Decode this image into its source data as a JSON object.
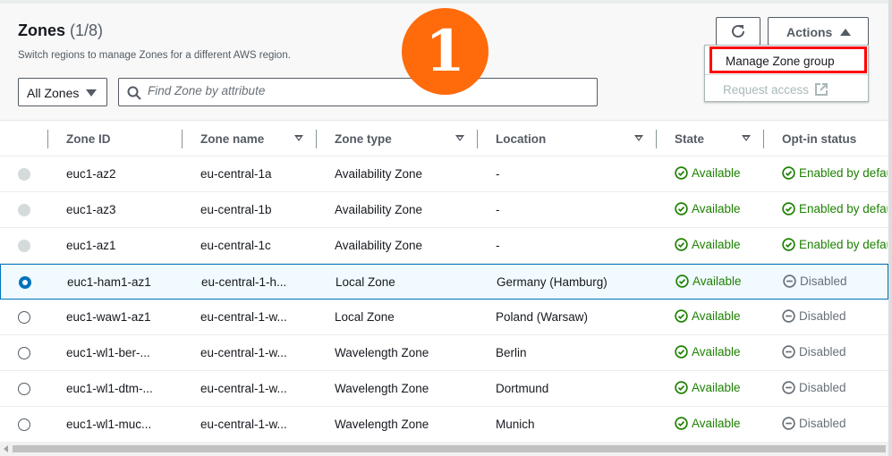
{
  "header": {
    "title": "Zones",
    "count": "(1/8)",
    "subtitle": "Switch regions to manage Zones for a different AWS region."
  },
  "filter": {
    "selected": "All Zones",
    "search_placeholder": "Find Zone by attribute"
  },
  "toolbar": {
    "refresh_icon": "refresh-icon",
    "actions_label": "Actions"
  },
  "actions_menu": {
    "items": [
      {
        "label": "Manage Zone group",
        "highlighted": true
      },
      {
        "label": "Request access",
        "disabled": true,
        "icon": "external-link-icon"
      }
    ]
  },
  "annotation": {
    "step": "1",
    "color": "#ff6a0b"
  },
  "table": {
    "columns": [
      "Zone ID",
      "Zone name",
      "Zone type",
      "Location",
      "State",
      "Opt-in status"
    ],
    "rows": [
      {
        "zone_id": "euc1-az2",
        "zone_name": "eu-central-1a",
        "zone_type": "Availability Zone",
        "location": "-",
        "state": "Available",
        "opt_in": "Enabled by default",
        "selectable": false,
        "selected": false
      },
      {
        "zone_id": "euc1-az3",
        "zone_name": "eu-central-1b",
        "zone_type": "Availability Zone",
        "location": "-",
        "state": "Available",
        "opt_in": "Enabled by default",
        "selectable": false,
        "selected": false
      },
      {
        "zone_id": "euc1-az1",
        "zone_name": "eu-central-1c",
        "zone_type": "Availability Zone",
        "location": "-",
        "state": "Available",
        "opt_in": "Enabled by default",
        "selectable": false,
        "selected": false
      },
      {
        "zone_id": "euc1-ham1-az1",
        "zone_name": "eu-central-1-h...",
        "zone_type": "Local Zone",
        "location": "Germany (Hamburg)",
        "state": "Available",
        "opt_in": "Disabled",
        "selectable": true,
        "selected": true
      },
      {
        "zone_id": "euc1-waw1-az1",
        "zone_name": "eu-central-1-w...",
        "zone_type": "Local Zone",
        "location": "Poland (Warsaw)",
        "state": "Available",
        "opt_in": "Disabled",
        "selectable": true,
        "selected": false
      },
      {
        "zone_id": "euc1-wl1-ber-...",
        "zone_name": "eu-central-1-w...",
        "zone_type": "Wavelength Zone",
        "location": "Berlin",
        "state": "Available",
        "opt_in": "Disabled",
        "selectable": true,
        "selected": false
      },
      {
        "zone_id": "euc1-wl1-dtm-...",
        "zone_name": "eu-central-1-w...",
        "zone_type": "Wavelength Zone",
        "location": "Dortmund",
        "state": "Available",
        "opt_in": "Disabled",
        "selectable": true,
        "selected": false
      },
      {
        "zone_id": "euc1-wl1-muc...",
        "zone_name": "eu-central-1-w...",
        "zone_type": "Wavelength Zone",
        "location": "Munich",
        "state": "Available",
        "opt_in": "Disabled",
        "selectable": true,
        "selected": false
      }
    ]
  },
  "colors": {
    "accent": "#0073bb",
    "success": "#1d8102",
    "highlight": "#ff0000"
  }
}
